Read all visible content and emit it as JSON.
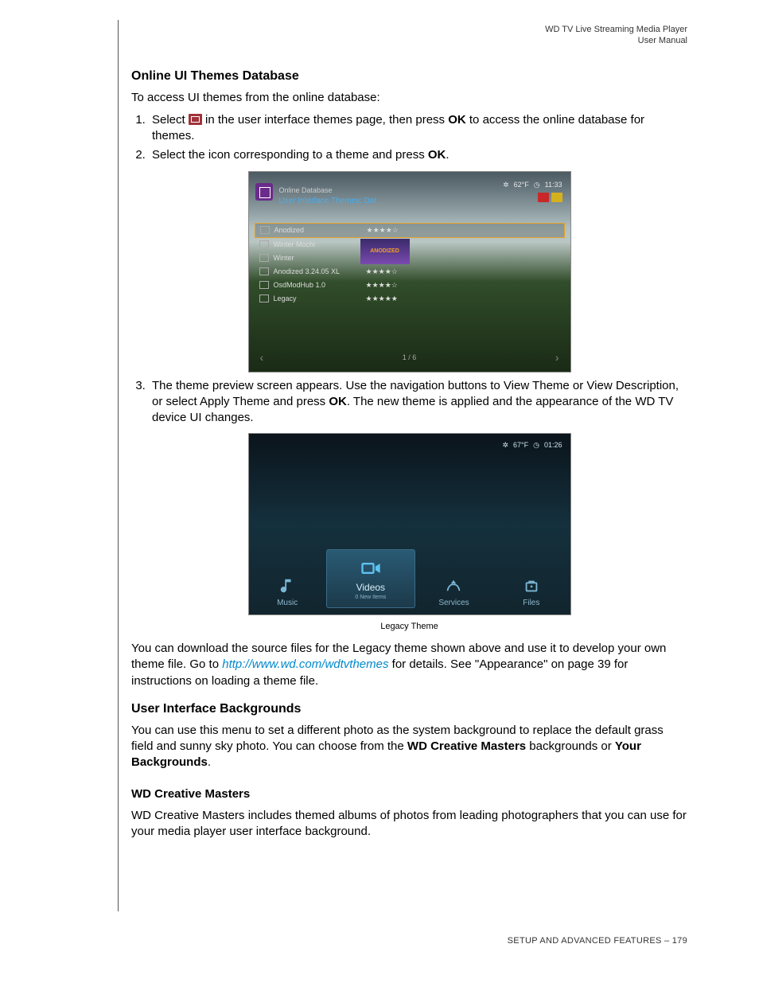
{
  "header": {
    "product": "WD TV Live Streaming Media Player",
    "manual": "User Manual"
  },
  "h_online": "Online UI Themes Database",
  "p_online": "To access UI themes from the online database:",
  "step1_a": "Select ",
  "step1_b": " in the user interface themes page, then press ",
  "ok": "OK",
  "step1_c": " to access the online database for themes.",
  "step2_a": "Select the icon corresponding to a theme and press ",
  "step2_b": ".",
  "shot1": {
    "weather_icon": "✲",
    "temp": "62°F",
    "clock_icon": "◷",
    "time": "11:33",
    "title": "Online Database",
    "subtitle": "User Interface Themes: Dat",
    "preview_label": "ANODIZED",
    "rows": [
      {
        "name": "Anodized",
        "stars": "★★★★☆"
      },
      {
        "name": "Winter Mochi",
        "stars": ""
      },
      {
        "name": "Winter",
        "stars": ""
      },
      {
        "name": "Anodized 3.24.05 XL",
        "stars": "★★★★☆"
      },
      {
        "name": "OsdModHub 1.0",
        "stars": "★★★★☆"
      },
      {
        "name": "Legacy",
        "stars": "★★★★★"
      }
    ],
    "nav_left": "‹",
    "nav_page": "1 / 6",
    "nav_right": "›"
  },
  "step3_a": "The theme preview screen appears. Use the navigation buttons to View Theme or View Description, or select Apply Theme and press ",
  "step3_b": ". The new theme is applied and the appearance of the WD TV device UI changes.",
  "shot2": {
    "weather_icon": "✲",
    "temp": "67°F",
    "clock_icon": "◷",
    "time": "01:26",
    "items": [
      {
        "label": "Music"
      },
      {
        "label": "Videos",
        "sub": "0 New Items"
      },
      {
        "label": "Services"
      },
      {
        "label": "Files"
      }
    ]
  },
  "caption2": "Legacy Theme",
  "p_download_a": "You can download the source files for the Legacy theme shown above and use it to develop your own theme file. Go to ",
  "link": "http://www.wd.com/wdtvthemes",
  "p_download_b": " for details. See \"Appearance\" on page 39 for instructions on loading a theme file.",
  "h_bg": "User Interface Backgrounds",
  "p_bg_a": "You can use this menu to set a different photo as the system background to replace the default grass field and sunny sky photo. You can choose from the ",
  "p_bg_b": "WD Creative Masters",
  "p_bg_c": " backgrounds or ",
  "p_bg_d": "Your Backgrounds",
  "p_bg_e": ".",
  "h_wcm": "WD Creative Masters",
  "p_wcm": "WD Creative Masters includes themed albums of photos from leading photographers that you can use for your media player user interface background.",
  "footer": {
    "section": "SETUP AND ADVANCED FEATURES",
    "sep": " – ",
    "page": "179"
  }
}
